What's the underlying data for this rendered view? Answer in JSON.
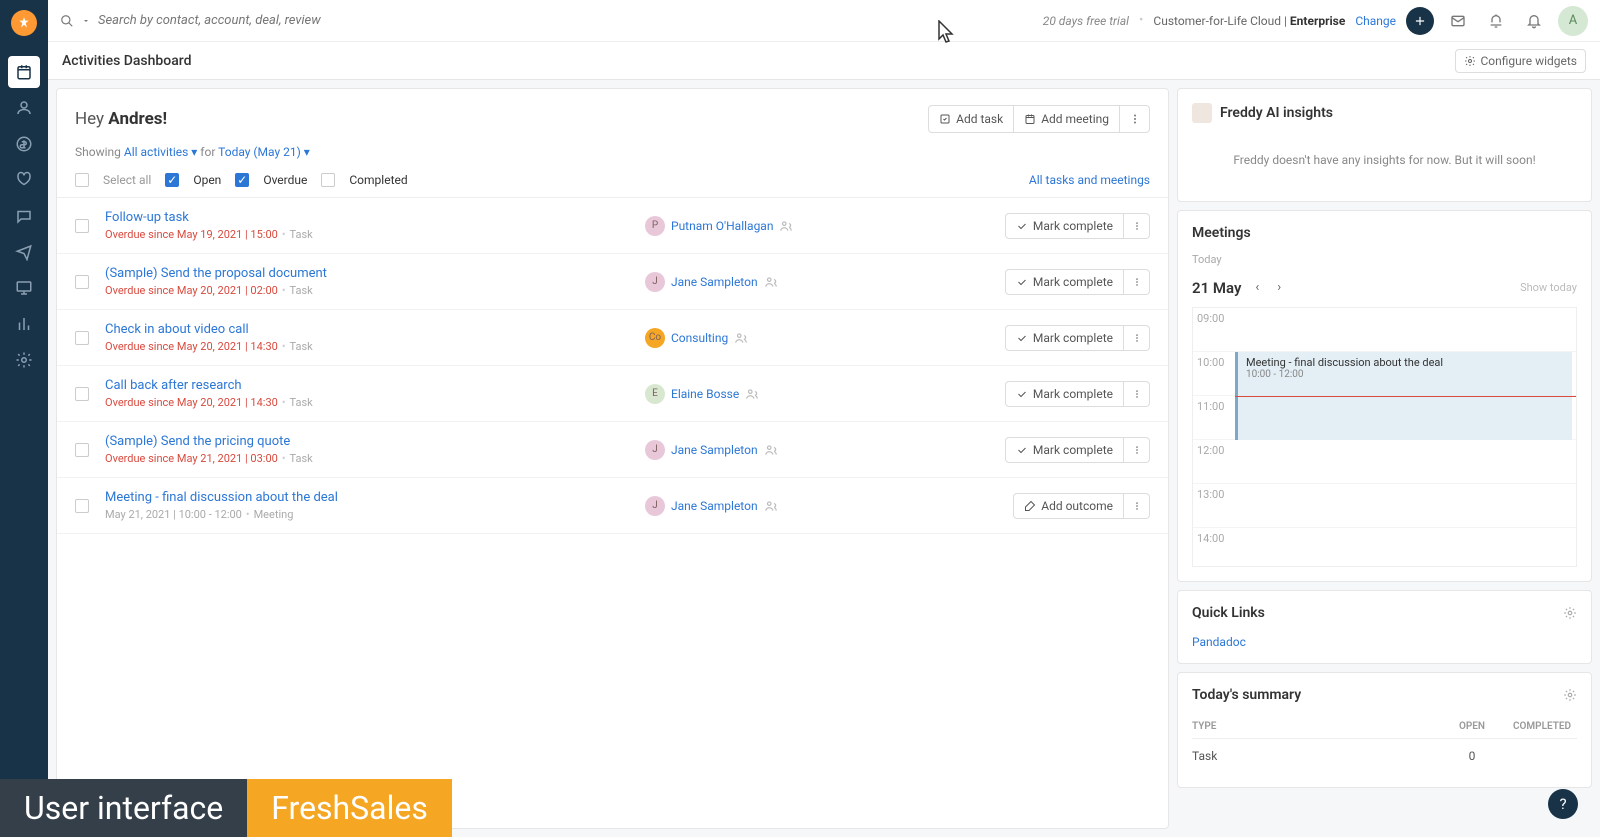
{
  "topbar": {
    "search_placeholder": "Search by contact, account, deal, review",
    "trial": "20 days free trial",
    "plan": "Customer-for-Life Cloud | ",
    "plan_bold": "Enterprise",
    "change": "Change",
    "avatar_initial": "A"
  },
  "subheader": {
    "title": "Activities Dashboard",
    "configure": "Configure widgets"
  },
  "greeting_prefix": "Hey ",
  "greeting_name": "Andres!",
  "header_actions": {
    "add_task": "Add task",
    "add_meeting": "Add meeting"
  },
  "filter": {
    "showing": "Showing",
    "all_activities": "All activities",
    "for": "for",
    "date": "Today (May 21)"
  },
  "status": {
    "select_all": "Select all",
    "open": "Open",
    "overdue": "Overdue",
    "completed": "Completed",
    "all_link": "All tasks and meetings"
  },
  "mark_complete": "Mark complete",
  "add_outcome": "Add outcome",
  "activities": [
    {
      "title": "Follow-up task",
      "overdue": "Overdue since May 19, 2021 | 15:00",
      "type": "Task",
      "contact": "Putnam O'Hallagan",
      "initial": "P",
      "color": "#e8c8d8",
      "action": "mark"
    },
    {
      "title": "(Sample) Send the proposal document",
      "overdue": "Overdue since May 20, 2021 | 02:00",
      "type": "Task",
      "contact": "Jane Sampleton",
      "initial": "J",
      "color": "#e8c8d8",
      "action": "mark"
    },
    {
      "title": "Check in about video call",
      "overdue": "Overdue since May 20, 2021 | 14:30",
      "type": "Task",
      "contact": "Consulting",
      "initial": "Co",
      "color": "#f5a623",
      "action": "mark"
    },
    {
      "title": "Call back after research",
      "overdue": "Overdue since May 20, 2021 | 14:30",
      "type": "Task",
      "contact": "Elaine Bosse",
      "initial": "E",
      "color": "#d8e8d0",
      "action": "mark"
    },
    {
      "title": "(Sample) Send the pricing quote",
      "overdue": "Overdue since May 21, 2021 | 03:00",
      "type": "Task",
      "contact": "Jane Sampleton",
      "initial": "J",
      "color": "#e8c8d8",
      "action": "mark"
    },
    {
      "title": "Meeting - final discussion about the deal",
      "overdue": "",
      "meta": "May 21, 2021 | 10:00 - 12:00",
      "type": "Meeting",
      "contact": "Jane Sampleton",
      "initial": "J",
      "color": "#e8c8d8",
      "action": "outcome"
    }
  ],
  "freddy": {
    "title": "Freddy AI insights",
    "empty": "Freddy doesn't have any insights for now. But it will soon!"
  },
  "meetings": {
    "title": "Meetings",
    "today": "Today",
    "date": "21 May",
    "show_today": "Show today",
    "times": [
      "09:00",
      "10:00",
      "11:00",
      "12:00",
      "13:00",
      "14:00"
    ],
    "event": {
      "title": "Meeting - final discussion about the deal",
      "time": "10:00 - 12:00"
    }
  },
  "quicklinks": {
    "title": "Quick Links",
    "items": [
      "Pandadoc"
    ]
  },
  "summary": {
    "title": "Today's summary",
    "headers": {
      "type": "TYPE",
      "open": "OPEN",
      "completed": "COMPLETED"
    },
    "rows": [
      {
        "type": "Task",
        "open": "0",
        "completed": ""
      }
    ]
  },
  "banner": {
    "left": "User interface",
    "right": "FreshSales"
  }
}
